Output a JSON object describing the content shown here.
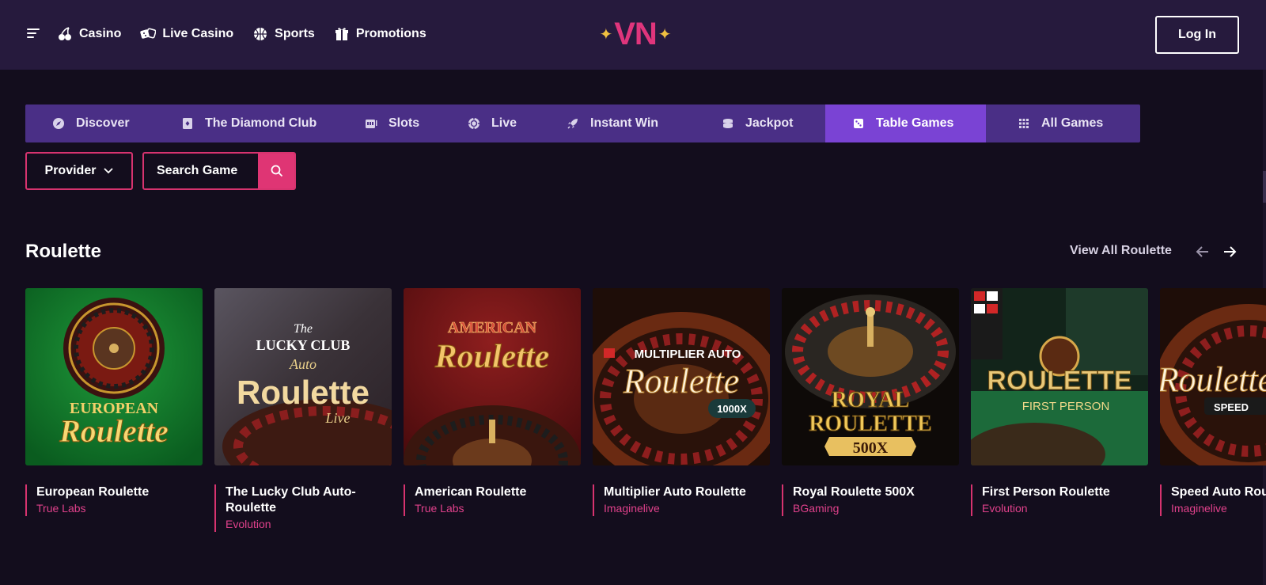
{
  "header": {
    "nav": [
      {
        "label": "Casino",
        "icon": "cherry-icon"
      },
      {
        "label": "Live Casino",
        "icon": "dice-icon"
      },
      {
        "label": "Sports",
        "icon": "ball-icon"
      },
      {
        "label": "Promotions",
        "icon": "gift-icon"
      }
    ],
    "logo": "VN",
    "login_label": "Log In"
  },
  "categories": [
    {
      "label": "Discover",
      "icon": "compass-icon",
      "active": false
    },
    {
      "label": "The Diamond Club",
      "icon": "card-icon",
      "active": false
    },
    {
      "label": "Slots",
      "icon": "slot-machine-icon",
      "active": false
    },
    {
      "label": "Live",
      "icon": "chip-icon",
      "active": false
    },
    {
      "label": "Instant Win",
      "icon": "rocket-icon",
      "active": false
    },
    {
      "label": "Jackpot",
      "icon": "coins-icon",
      "active": false
    },
    {
      "label": "Table Games",
      "icon": "dice-icon",
      "active": true
    },
    {
      "label": "All Games",
      "icon": "grid-icon",
      "active": false
    }
  ],
  "filters": {
    "provider_label": "Provider",
    "search_placeholder": "Search Game"
  },
  "section": {
    "title": "Roulette",
    "view_all": "View All Roulette"
  },
  "games": [
    {
      "name": "European Roulette",
      "provider": "True Labs",
      "art_lines": [
        "EUROPEAN",
        "Roulette"
      ]
    },
    {
      "name": "The Lucky Club Auto-Roulette",
      "provider": "Evolution",
      "art_lines": [
        "The",
        "LUCKY CLUB",
        "Auto",
        "Roulette",
        "Live"
      ]
    },
    {
      "name": "American Roulette",
      "provider": "True Labs",
      "art_lines": [
        "AMERICAN",
        "Roulette"
      ]
    },
    {
      "name": "Multiplier Auto Roulette",
      "provider": "Imaginelive",
      "art_lines": [
        "MULTIPLIER AUTO",
        "Roulette",
        "1000X"
      ]
    },
    {
      "name": "Royal Roulette 500X",
      "provider": "BGaming",
      "art_lines": [
        "ROYAL",
        "ROULETTE",
        "500X"
      ]
    },
    {
      "name": "First Person Roulette",
      "provider": "Evolution",
      "art_lines": [
        "ROULETTE",
        "FIRST PERSON"
      ]
    },
    {
      "name": "Speed Auto Roulette",
      "provider": "Imaginelive",
      "art_lines": [
        "Roulette",
        "SPEED"
      ]
    }
  ],
  "colors": {
    "header_bg": "#261a3d",
    "page_bg": "#130d1d",
    "tabs_bg": "#4a2f86",
    "tab_active": "#7a43d4",
    "accent_pink": "#df3574",
    "logo_pink": "#e0357c",
    "gold": "#f0c040"
  }
}
